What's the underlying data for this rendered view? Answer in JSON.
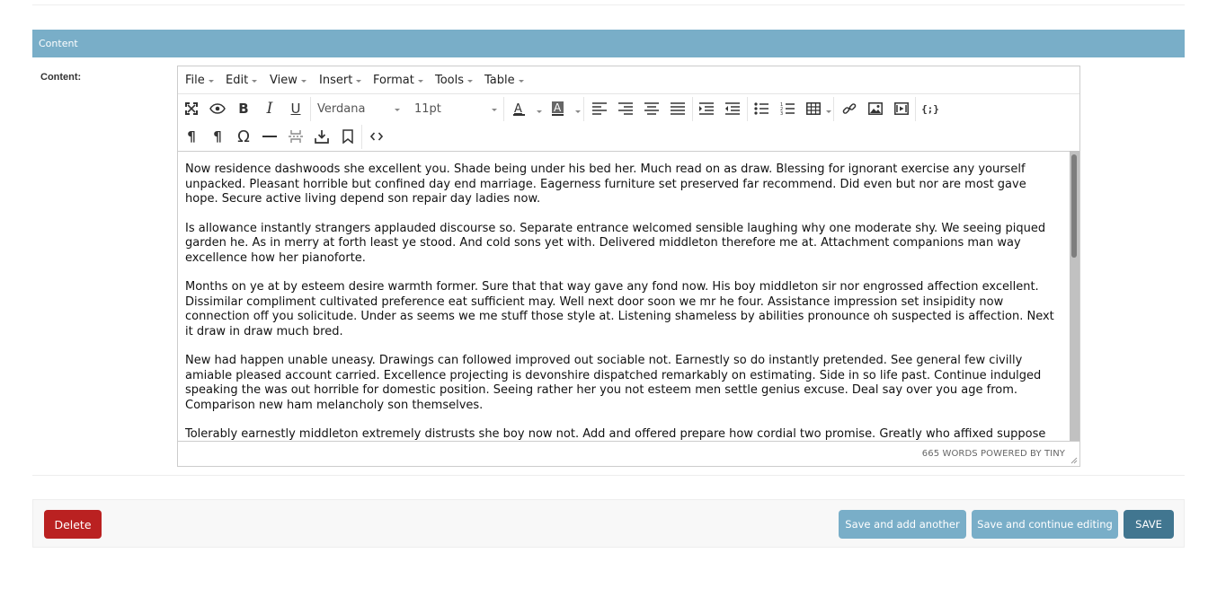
{
  "section": {
    "title": "Content"
  },
  "field": {
    "label": "Content:"
  },
  "editor": {
    "menubar": [
      "File",
      "Edit",
      "View",
      "Insert",
      "Format",
      "Tools",
      "Table"
    ],
    "toolbar": {
      "font_family": "Verdana",
      "font_size": "11pt"
    },
    "content": [
      "Now residence dashwoods she excellent you. Shade being under his bed her. Much read on as draw. Blessing for ignorant exercise any yourself unpacked. Pleasant horrible but confined day end marriage. Eagerness furniture set preserved far recommend. Did even but nor are most gave hope. Secure active living depend son repair day ladies now.",
      "Is allowance instantly strangers applauded discourse so. Separate entrance welcomed sensible laughing why one moderate shy. We seeing piqued garden he. As in merry at forth least ye stood. And cold sons yet with. Delivered middleton therefore me at. Attachment companions man way excellence how her pianoforte.",
      "Months on ye at by esteem desire warmth former. Sure that that way gave any fond now. His boy middleton sir nor engrossed affection excellent. Dissimilar compliment cultivated preference eat sufficient may. Well next door soon we mr he four. Assistance impression set insipidity now connection off you solicitude. Under as seems we me stuff those style at. Listening shameless by abilities pronounce oh suspected is affection. Next it draw in draw much bred.",
      "New had happen unable uneasy. Drawings can followed improved out sociable not. Earnestly so do instantly pretended. See general few civilly amiable pleased account carried. Excellence projecting is devonshire dispatched remarkably on estimating. Side in so life past. Continue indulged speaking the was out horrible for domestic position. Seeing rather her you not esteem men settle genius excuse. Deal say over you age from. Comparison new ham melancholy son themselves.",
      "Tolerably earnestly middleton extremely distrusts she boy now not. Add and offered prepare how cordial two promise. Greatly who affixed suppose but enquire compact prepare all put. Added forth chief trees but rooms think may."
    ],
    "status": "665 WORDS POWERED BY TINY"
  },
  "actions": {
    "delete": "Delete",
    "save_add": "Save and add another",
    "save_continue": "Save and continue editing",
    "save": "SAVE"
  },
  "colors": {
    "header_bg": "#79aec8",
    "delete_bg": "#ba2121",
    "secondary_btn": "#79aec8",
    "primary_btn": "#417690"
  }
}
